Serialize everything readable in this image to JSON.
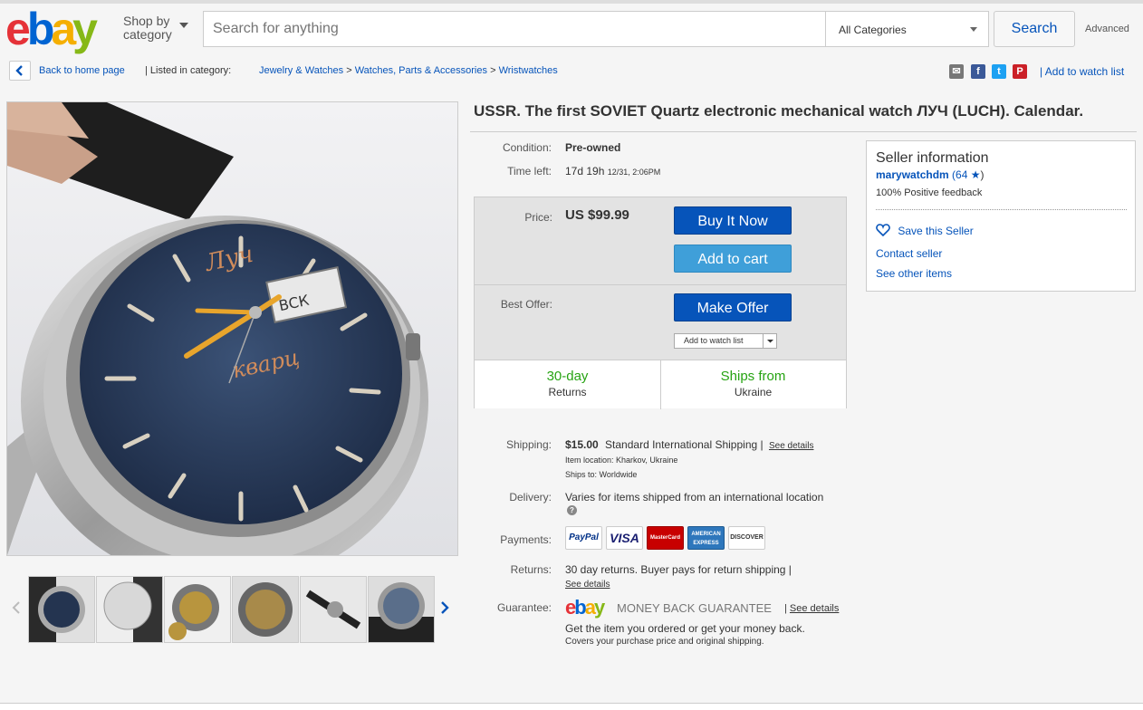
{
  "header": {
    "logo_letters": [
      "e",
      "b",
      "a",
      "y"
    ],
    "logo_colors": [
      "#e53238",
      "#0064d2",
      "#f5af02",
      "#86b817"
    ],
    "shop_by_line1": "Shop by",
    "shop_by_line2": "category",
    "search_placeholder": "Search for anything",
    "category_selected": "All Categories",
    "search_button": "Search",
    "advanced": "Advanced"
  },
  "breadcrumb": {
    "back": "Back to home page",
    "listed_in": "| Listed in category:",
    "crumbs": [
      "Jewelry & Watches",
      "Watches, Parts & Accessories",
      "Wristwatches"
    ],
    "sep": ">",
    "add_watch": "| Add to watch list"
  },
  "item": {
    "title": "USSR. The first SOVIET Quartz electronic mechanical watch ЛУЧ (LUCH). Calendar.",
    "condition_label": "Condition:",
    "condition": "Pre-owned",
    "time_left_label": "Time left:",
    "time_left": "17d 19h",
    "time_left_end": "12/31, 2:06PM",
    "price_label": "Price:",
    "price": "US $99.99",
    "buy_now": "Buy It Now",
    "add_to_cart": "Add to cart",
    "best_offer_label": "Best Offer:",
    "make_offer": "Make Offer",
    "add_watch_list": "Add to watch list",
    "returns_days": "30-day",
    "returns_label": "Returns",
    "ships_from_label": "Ships from",
    "ships_from": "Ukraine"
  },
  "shipping": {
    "label": "Shipping:",
    "cost": "$15.00",
    "method": "Standard International Shipping |",
    "see_details": "See details",
    "item_location": "Item location:  Kharkov, Ukraine",
    "ships_to": "Ships to:  Worldwide",
    "delivery_label": "Delivery:",
    "delivery": "Varies for items shipped from an international location",
    "payments_label": "Payments:",
    "payments": [
      "PayPal",
      "VISA",
      "MasterCard",
      "AMERICAN EXPRESS",
      "DISCOVER"
    ],
    "returns_label": "Returns:",
    "returns": "30 day returns. Buyer pays for return shipping |",
    "returns_see": "See details",
    "guarantee_label": "Guarantee:",
    "guarantee_title": "MONEY BACK GUARANTEE",
    "guarantee_see": "See details",
    "guarantee_line1": "Get the item you ordered or get your money back.",
    "guarantee_line2": "Covers your purchase price and original shipping."
  },
  "seller": {
    "heading": "Seller information",
    "name": "marywatchdm",
    "score": "(64",
    "score_close": ")",
    "feedback": "100% Positive feedback",
    "save": "Save this Seller",
    "contact": "Contact seller",
    "other": "See other items"
  },
  "watch_face": {
    "brand": "Луч",
    "model": "кварц",
    "day": "ВСК"
  }
}
